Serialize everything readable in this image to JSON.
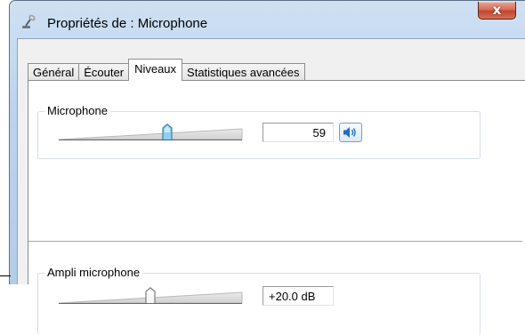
{
  "window": {
    "title": "Propriétés de : Microphone",
    "close_label": "x"
  },
  "tabs": [
    {
      "label": "Général",
      "active": false
    },
    {
      "label": "Écouter",
      "active": false
    },
    {
      "label": "Niveaux",
      "active": true
    },
    {
      "label": "Statistiques avancées",
      "active": false
    }
  ],
  "levels": {
    "microphone": {
      "label": "Microphone",
      "value": "59",
      "slider_fraction": 0.59,
      "mute_icon": "speaker-icon"
    },
    "boost": {
      "label": "Ampli microphone",
      "value": "+20.0 dB",
      "slider_fraction": 0.5
    }
  },
  "colors": {
    "titlebar": "#bcd3ec",
    "close_button": "#c2442c",
    "thumb": "#7fc4ea"
  }
}
